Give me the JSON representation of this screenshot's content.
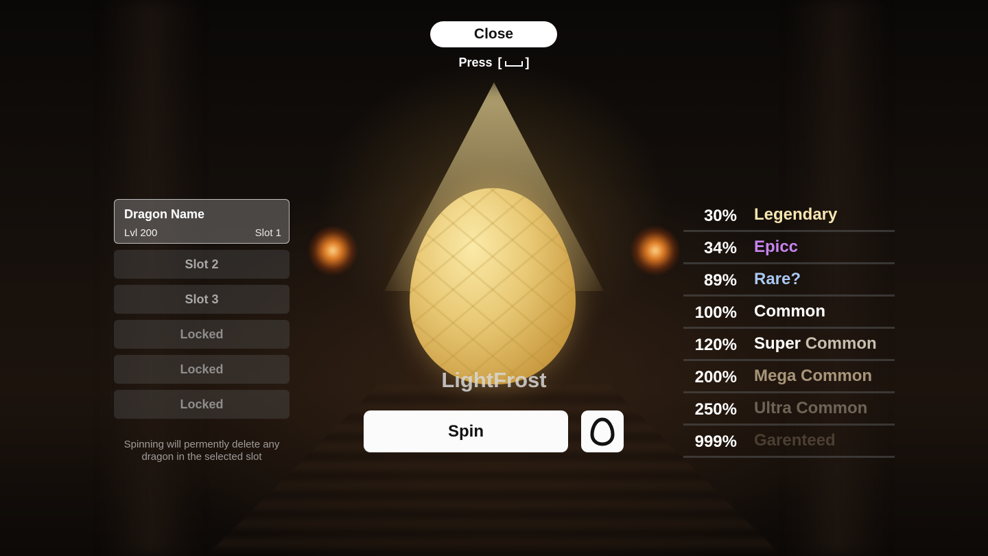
{
  "close": {
    "label": "Close",
    "hint_prefix": "Press",
    "hint_key_open": "[",
    "hint_key_close": "]"
  },
  "slots": {
    "selected": {
      "name": "Dragon Name",
      "level": "Lvl 200",
      "slot": "Slot 1"
    },
    "others": [
      {
        "label": "Slot 2",
        "locked": false
      },
      {
        "label": "Slot 3",
        "locked": false
      },
      {
        "label": "Locked",
        "locked": true
      },
      {
        "label": "Locked",
        "locked": true
      },
      {
        "label": "Locked",
        "locked": true
      }
    ],
    "warning": "Spinning will permently delete any dragon in the selected slot"
  },
  "egg": {
    "name": "LightFrost"
  },
  "actions": {
    "spin_label": "Spin",
    "egg_icon": "egg-outline-icon"
  },
  "odds": [
    {
      "percent": "30%",
      "rarity": "Legendary",
      "color": "#f7e6b0"
    },
    {
      "percent": "34%",
      "rarity": "Epicc",
      "color": "#c784f0"
    },
    {
      "percent": "89%",
      "rarity": "Rare?",
      "color": "#a9c8f2"
    },
    {
      "percent": "100%",
      "rarity": "Common",
      "color": "#ffffff"
    },
    {
      "percent": "120%",
      "rarity_prefix": "Super ",
      "rarity": "Common",
      "prefix_color": "#ffffff",
      "color": "#c8bfae"
    },
    {
      "percent": "200%",
      "rarity": "Mega Common",
      "color": "#a8957a"
    },
    {
      "percent": "250%",
      "rarity": "Ultra Common",
      "color": "#6e6456"
    },
    {
      "percent": "999%",
      "rarity": "Garenteed",
      "color": "#4a3f31"
    }
  ]
}
